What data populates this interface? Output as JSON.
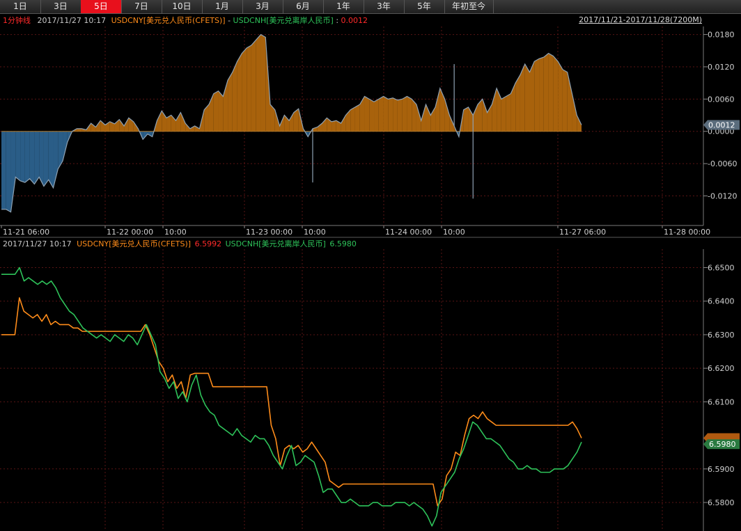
{
  "tabs": [
    {
      "label": "1日",
      "active": false
    },
    {
      "label": "3日",
      "active": false
    },
    {
      "label": "5日",
      "active": true
    },
    {
      "label": "7日",
      "active": false
    },
    {
      "label": "10日",
      "active": false
    },
    {
      "label": "1月",
      "active": false
    },
    {
      "label": "3月",
      "active": false
    },
    {
      "label": "6月",
      "active": false
    },
    {
      "label": "1年",
      "active": false
    },
    {
      "label": "3年",
      "active": false
    },
    {
      "label": "5年",
      "active": false
    },
    {
      "label": "年初至今",
      "active": false
    }
  ],
  "top_header": {
    "interval": "1分钟线",
    "timestamp": "2017/11/27 10:17",
    "series_a": "USDCNY[美元兑人民币(CFETS)]",
    "separator": " - ",
    "series_b": "USDCNH[美元兑离岸人民币]",
    "colon": " : ",
    "value": "0.0012",
    "range": "2017/11/21-2017/11/28(7200M)"
  },
  "bottom_header": {
    "timestamp": "2017/11/27 10:17",
    "series_a": "USDCNY[美元兑人民币(CFETS)]",
    "value_a": "6.5992",
    "series_b": "USDCNH[美元兑离岸人民币]",
    "value_b": "6.5980"
  },
  "colors": {
    "cny": "#ff8c1a",
    "cnh": "#2ec35a",
    "pos_fill": "#a8620c",
    "neg_fill": "#2a5d87",
    "spread_line": "#8fa2b3",
    "grid": "#5a1414",
    "red_text": "#ff2a2a"
  },
  "chart_data": [
    {
      "type": "area",
      "x_ticks": [
        "11-21 06:00",
        "11-22 00:00",
        "10:00",
        "11-23 00:00",
        "10:00",
        "11-24 00:00",
        "10:00",
        "11-27 06:00",
        "11-28 00:00"
      ],
      "y_ticks": [
        "0.0180",
        "0.0120",
        "0.0060",
        "0.0000",
        "-0.0060",
        "-0.0120"
      ],
      "ylim": [
        -0.0175,
        0.0195
      ],
      "current_label": "0.0012",
      "y": [
        -0.0145,
        -0.0145,
        -0.015,
        -0.0085,
        -0.0092,
        -0.0095,
        -0.0088,
        -0.0098,
        -0.0085,
        -0.0102,
        -0.009,
        -0.0105,
        -0.007,
        -0.0055,
        -0.002,
        0.0,
        0.0005,
        0.0005,
        0.0003,
        0.0015,
        0.0008,
        0.002,
        0.0012,
        0.0018,
        0.0014,
        0.0022,
        0.001,
        0.0025,
        0.0018,
        0.0005,
        -0.0015,
        -0.0005,
        -0.001,
        0.002,
        0.0038,
        0.0025,
        0.003,
        0.002,
        0.0035,
        0.0015,
        0.0005,
        0.001,
        0.0005,
        0.004,
        0.005,
        0.007,
        0.0075,
        0.0065,
        0.0095,
        0.011,
        0.013,
        0.0145,
        0.0155,
        0.016,
        0.017,
        0.018,
        0.0175,
        0.005,
        0.004,
        0.001,
        0.003,
        0.002,
        0.0035,
        0.0042,
        0.0005,
        -0.001,
        0.0005,
        0.0008,
        0.0015,
        0.0025,
        0.0018,
        0.002,
        0.0015,
        0.003,
        0.004,
        0.0045,
        0.005,
        0.0065,
        0.006,
        0.0055,
        0.006,
        0.0065,
        0.006,
        0.0062,
        0.0058,
        0.006,
        0.0065,
        0.006,
        0.005,
        0.002,
        0.005,
        0.003,
        0.0045,
        0.008,
        0.006,
        0.003,
        0.001,
        -0.001,
        0.004,
        0.0045,
        0.003,
        0.005,
        0.006,
        0.0035,
        0.005,
        0.008,
        0.006,
        0.0065,
        0.007,
        0.009,
        0.0105,
        0.0125,
        0.011,
        0.013,
        0.0135,
        0.0138,
        0.0145,
        0.014,
        0.013,
        0.0115,
        0.011,
        0.007,
        0.003,
        0.0012
      ],
      "spikes": [
        {
          "i": 66,
          "y": -0.0095
        },
        {
          "i": 96,
          "y": 0.0125
        },
        {
          "i": 100,
          "y": -0.0125
        }
      ]
    },
    {
      "type": "line",
      "x_ticks": [],
      "y_ticks": [
        "6.6500",
        "6.6400",
        "6.6300",
        "6.6200",
        "6.6100",
        "6.5900",
        "6.5800"
      ],
      "ylim": [
        6.5715,
        6.6555
      ],
      "series": [
        {
          "name": "USDCNY[美元兑人民币(CFETS)]",
          "color": "#ff8c1a",
          "values": [
            6.63,
            6.63,
            6.63,
            6.63,
            6.641,
            6.637,
            6.636,
            6.635,
            6.636,
            6.634,
            6.636,
            6.633,
            6.634,
            6.633,
            6.633,
            6.633,
            6.632,
            6.632,
            6.631,
            6.631,
            6.631,
            6.631,
            6.631,
            6.631,
            6.631,
            6.631,
            6.631,
            6.631,
            6.631,
            6.631,
            6.631,
            6.631,
            6.633,
            6.63,
            6.626,
            6.622,
            6.62,
            6.616,
            6.618,
            6.614,
            6.616,
            6.611,
            6.618,
            6.6185,
            6.6185,
            6.6185,
            6.6185,
            6.6145,
            6.6145,
            6.6145,
            6.6145,
            6.6145,
            6.6145,
            6.6145,
            6.6145,
            6.6145,
            6.6145,
            6.6145,
            6.6145,
            6.6145,
            6.603,
            6.599,
            6.591,
            6.596,
            6.597,
            6.596,
            6.597,
            6.595,
            6.596,
            6.598,
            6.596,
            6.594,
            6.592,
            6.5865,
            6.5855,
            6.5845,
            6.5855,
            6.5855,
            6.5855,
            6.5855,
            6.5855,
            6.5855,
            6.5855,
            6.5855,
            6.5855,
            6.5855,
            6.5855,
            6.5855,
            6.5855,
            6.5855,
            6.5855,
            6.5855,
            6.5855,
            6.5855,
            6.5855,
            6.5855,
            6.5855,
            6.579,
            6.581,
            6.588,
            6.59,
            6.595,
            6.594,
            6.6,
            6.605,
            6.606,
            6.605,
            6.607,
            6.605,
            6.604,
            6.603,
            6.603,
            6.603,
            6.603,
            6.603,
            6.603,
            6.603,
            6.603,
            6.603,
            6.603,
            6.603,
            6.603,
            6.603,
            6.603,
            6.603,
            6.603,
            6.603,
            6.604,
            6.602,
            6.5992
          ]
        },
        {
          "name": "USDCNH[美元兑离岸人民币]",
          "color": "#2ec35a",
          "values": [
            6.648,
            6.648,
            6.648,
            6.648,
            6.65,
            6.646,
            6.647,
            6.646,
            6.645,
            6.646,
            6.645,
            6.646,
            6.644,
            6.641,
            6.639,
            6.637,
            6.636,
            6.634,
            6.632,
            6.631,
            6.63,
            6.629,
            6.63,
            6.629,
            6.628,
            6.63,
            6.629,
            6.628,
            6.63,
            6.629,
            6.627,
            6.63,
            6.633,
            6.63,
            6.627,
            6.619,
            6.617,
            6.614,
            6.616,
            6.611,
            6.613,
            6.61,
            6.615,
            6.618,
            6.612,
            6.609,
            6.607,
            6.606,
            6.603,
            6.602,
            6.601,
            6.6,
            6.602,
            6.6,
            6.599,
            6.598,
            6.6,
            6.599,
            6.599,
            6.597,
            6.594,
            6.592,
            6.59,
            6.594,
            6.597,
            6.591,
            6.592,
            6.594,
            6.593,
            6.592,
            6.588,
            6.583,
            6.584,
            6.584,
            6.582,
            6.58,
            6.58,
            6.581,
            6.58,
            6.579,
            6.579,
            6.579,
            6.58,
            6.58,
            6.579,
            6.579,
            6.579,
            6.58,
            6.58,
            6.58,
            6.579,
            6.58,
            6.579,
            6.578,
            6.576,
            6.573,
            6.576,
            6.583,
            6.585,
            6.587,
            6.589,
            6.593,
            6.596,
            6.6,
            6.604,
            6.603,
            6.601,
            6.599,
            6.599,
            6.598,
            6.597,
            6.595,
            6.593,
            6.592,
            6.59,
            6.59,
            6.591,
            6.59,
            6.59,
            6.589,
            6.589,
            6.589,
            6.59,
            6.59,
            6.59,
            6.591,
            6.593,
            6.595,
            6.598
          ]
        }
      ]
    }
  ]
}
